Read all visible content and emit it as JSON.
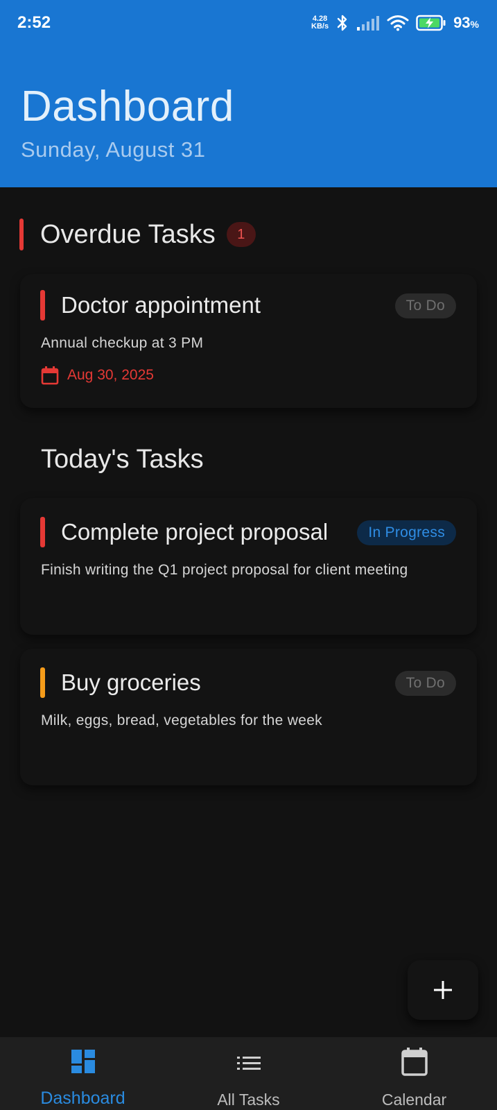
{
  "status_bar": {
    "time": "2:52",
    "net_speed_value": "4.28",
    "net_speed_unit": "KB/s",
    "battery_percent": "93",
    "battery_symbol": "%"
  },
  "header": {
    "title": "Dashboard",
    "subtitle": "Sunday, August 31",
    "color": "#1976d2"
  },
  "overdue": {
    "title": "Overdue Tasks",
    "count": "1",
    "tasks": [
      {
        "title": "Doctor appointment",
        "description": "Annual checkup at 3 PM",
        "status": "To Do",
        "due_date": "Aug 30, 2025",
        "priority_color": "#e53935"
      }
    ]
  },
  "today": {
    "title": "Today's Tasks",
    "tasks": [
      {
        "title": "Complete project proposal",
        "description": "Finish writing the Q1 project proposal for client meeting",
        "status": "In Progress",
        "priority_color": "#e53935"
      },
      {
        "title": "Buy groceries",
        "description": "Milk, eggs, bread, vegetables for the week",
        "status": "To Do",
        "priority_color": "#f59c1a"
      }
    ]
  },
  "fab": {
    "icon": "plus-icon"
  },
  "bottom_nav": {
    "items": [
      {
        "label": "Dashboard",
        "icon": "dashboard-icon",
        "active": true
      },
      {
        "label": "All Tasks",
        "icon": "list-icon",
        "active": false
      },
      {
        "label": "Calendar",
        "icon": "calendar-icon",
        "active": false
      }
    ],
    "active_color": "#2a8be0"
  }
}
